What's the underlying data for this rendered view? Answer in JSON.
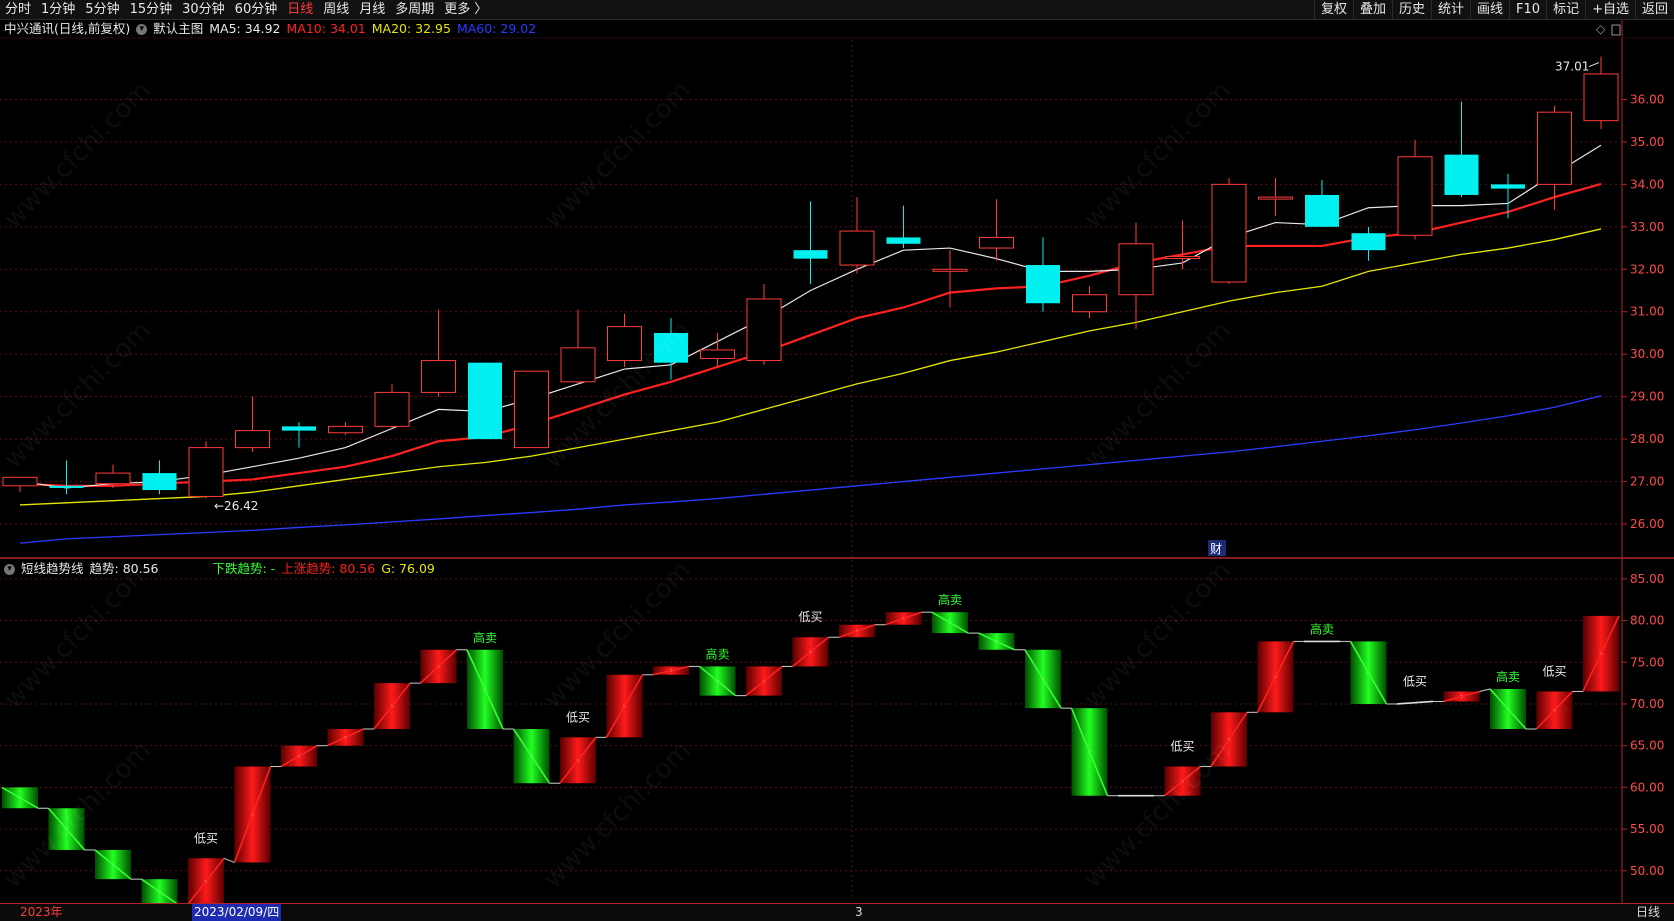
{
  "toolbar": {
    "left": [
      "分时",
      "1分钟",
      "5分钟",
      "15分钟",
      "30分钟",
      "60分钟",
      "日线",
      "周线",
      "月线",
      "多周期",
      "更多 〉"
    ],
    "active": "日线",
    "right": [
      "复权",
      "叠加",
      "历史",
      "统计",
      "画线",
      "F10",
      "标记",
      "+自选",
      "返回"
    ]
  },
  "legend_main": {
    "title": "中兴通讯(日线,前复权)",
    "template": "默认主图",
    "ma5": "MA5: 34.92",
    "ma10": "MA10: 34.01",
    "ma20": "MA20: 32.95",
    "ma60": "MA60: 29.02"
  },
  "legend_sub": {
    "title": "短线趋势线",
    "trend": "趋势: 80.56",
    "down": "下跌趋势: -",
    "up": "上涨趋势: 80.56",
    "g": "G: 76.09"
  },
  "annotations": {
    "high_price": "37.01",
    "low_price": "26.42",
    "fin_marker": "财"
  },
  "date_bar": {
    "year": "2023年",
    "selected": "2023/02/09/四",
    "month": "3",
    "period": "日线"
  },
  "watermark": "www.cfchi.com",
  "colors": {
    "up": "#ff3b3b",
    "down": "#00f0f0",
    "ma5": "#e8e8e8",
    "ma10": "#ff2020",
    "ma20": "#e6e600",
    "ma60": "#2b3bff",
    "grid": "#5a0f0f",
    "axis": "#b0262a"
  },
  "chart_data": [
    {
      "type": "candlestick",
      "title": "中兴通讯(日线,前复权)",
      "y_ticks": [
        26.0,
        27.0,
        28.0,
        29.0,
        30.0,
        31.0,
        32.0,
        33.0,
        34.0,
        35.0,
        36.0
      ],
      "ylim": [
        25.2,
        37.4
      ],
      "candles": [
        {
          "o": 26.9,
          "h": 27.05,
          "l": 26.75,
          "c": 27.1
        },
        {
          "o": 26.9,
          "h": 27.5,
          "l": 26.7,
          "c": 26.85
        },
        {
          "o": 26.95,
          "h": 27.4,
          "l": 26.85,
          "c": 27.2
        },
        {
          "o": 27.2,
          "h": 27.5,
          "l": 26.7,
          "c": 26.8
        },
        {
          "o": 26.65,
          "h": 27.95,
          "l": 26.6,
          "c": 27.8
        },
        {
          "o": 27.8,
          "h": 29.0,
          "l": 27.7,
          "c": 28.2
        },
        {
          "o": 28.3,
          "h": 28.4,
          "l": 27.8,
          "c": 28.2
        },
        {
          "o": 28.15,
          "h": 28.4,
          "l": 28.1,
          "c": 28.3
        },
        {
          "o": 28.3,
          "h": 29.3,
          "l": 28.25,
          "c": 29.1
        },
        {
          "o": 29.1,
          "h": 31.05,
          "l": 29.0,
          "c": 29.85
        },
        {
          "o": 29.8,
          "h": 29.8,
          "l": 28.0,
          "c": 28.0
        },
        {
          "o": 27.8,
          "h": 29.6,
          "l": 27.8,
          "c": 29.6
        },
        {
          "o": 29.35,
          "h": 31.05,
          "l": 29.3,
          "c": 30.15
        },
        {
          "o": 29.85,
          "h": 30.95,
          "l": 29.7,
          "c": 30.65
        },
        {
          "o": 30.5,
          "h": 30.85,
          "l": 29.4,
          "c": 29.8
        },
        {
          "o": 29.9,
          "h": 30.5,
          "l": 29.7,
          "c": 30.1
        },
        {
          "o": 29.85,
          "h": 31.65,
          "l": 29.75,
          "c": 31.3
        },
        {
          "o": 32.45,
          "h": 33.6,
          "l": 31.65,
          "c": 32.25
        },
        {
          "o": 32.1,
          "h": 33.7,
          "l": 31.9,
          "c": 32.9
        },
        {
          "o": 32.75,
          "h": 33.5,
          "l": 32.5,
          "c": 32.6
        },
        {
          "o": 32.0,
          "h": 32.45,
          "l": 31.1,
          "c": 32.0
        },
        {
          "o": 32.5,
          "h": 33.65,
          "l": 32.2,
          "c": 32.75
        },
        {
          "o": 32.1,
          "h": 32.75,
          "l": 31.0,
          "c": 31.2
        },
        {
          "o": 31.0,
          "h": 31.6,
          "l": 30.85,
          "c": 31.4
        },
        {
          "o": 31.4,
          "h": 33.1,
          "l": 30.6,
          "c": 32.6
        },
        {
          "o": 32.3,
          "h": 33.15,
          "l": 32.0,
          "c": 32.3
        },
        {
          "o": 31.7,
          "h": 34.15,
          "l": 31.65,
          "c": 34.0
        },
        {
          "o": 33.7,
          "h": 34.15,
          "l": 33.25,
          "c": 33.7
        },
        {
          "o": 33.75,
          "h": 34.1,
          "l": 33.0,
          "c": 33.0
        },
        {
          "o": 32.85,
          "h": 33.0,
          "l": 32.2,
          "c": 32.45
        },
        {
          "o": 32.8,
          "h": 35.05,
          "l": 32.7,
          "c": 34.65
        },
        {
          "o": 34.7,
          "h": 35.95,
          "l": 33.7,
          "c": 33.75
        },
        {
          "o": 34.0,
          "h": 34.25,
          "l": 33.2,
          "c": 33.9
        },
        {
          "o": 34.0,
          "h": 35.85,
          "l": 33.4,
          "c": 35.7
        },
        {
          "o": 35.5,
          "h": 37.01,
          "l": 35.3,
          "c": 36.6
        }
      ],
      "ma5": [
        27.0,
        26.85,
        26.95,
        27.0,
        27.15,
        27.35,
        27.55,
        27.8,
        28.25,
        28.7,
        28.65,
        28.95,
        29.3,
        29.65,
        29.75,
        30.3,
        30.85,
        31.5,
        32.0,
        32.45,
        32.5,
        32.25,
        31.95,
        31.95,
        32.0,
        32.15,
        32.75,
        33.1,
        33.05,
        33.45,
        33.5,
        33.5,
        33.55,
        34.25,
        34.92
      ],
      "ma10": [
        26.95,
        26.9,
        26.9,
        26.95,
        27.0,
        27.05,
        27.2,
        27.35,
        27.6,
        27.95,
        28.05,
        28.35,
        28.7,
        29.05,
        29.35,
        29.7,
        30.05,
        30.45,
        30.85,
        31.1,
        31.45,
        31.55,
        31.6,
        31.85,
        32.15,
        32.35,
        32.55,
        32.55,
        32.55,
        32.75,
        32.85,
        33.1,
        33.35,
        33.7,
        34.01
      ],
      "ma20": [
        26.45,
        26.5,
        26.55,
        26.6,
        26.65,
        26.75,
        26.9,
        27.05,
        27.2,
        27.35,
        27.45,
        27.6,
        27.8,
        28.0,
        28.2,
        28.4,
        28.7,
        29.0,
        29.3,
        29.55,
        29.85,
        30.05,
        30.3,
        30.55,
        30.75,
        31.0,
        31.25,
        31.45,
        31.6,
        31.95,
        32.15,
        32.35,
        32.5,
        32.7,
        32.95
      ],
      "ma60": [
        25.55,
        25.65,
        25.7,
        25.75,
        25.8,
        25.85,
        25.92,
        25.98,
        26.05,
        26.12,
        26.2,
        26.27,
        26.35,
        26.45,
        26.52,
        26.6,
        26.7,
        26.8,
        26.9,
        27.0,
        27.1,
        27.2,
        27.3,
        27.4,
        27.5,
        27.6,
        27.7,
        27.82,
        27.95,
        28.08,
        28.22,
        28.38,
        28.55,
        28.75,
        29.02
      ]
    },
    {
      "type": "bar",
      "title": "短线趋势线",
      "y_ticks": [
        50.0,
        55.0,
        60.0,
        65.0,
        70.0,
        75.0,
        80.0,
        85.0
      ],
      "ylim": [
        46.5,
        87.5
      ],
      "bars": [
        {
          "a": 60.0,
          "b": 57.5,
          "dir": "down"
        },
        {
          "a": 57.5,
          "b": 52.5,
          "dir": "down"
        },
        {
          "a": 52.5,
          "b": 49.0,
          "dir": "down"
        },
        {
          "a": 49.0,
          "b": 46.0,
          "dir": "down"
        },
        {
          "a": 46.0,
          "b": 51.5,
          "dir": "up",
          "label": "低买"
        },
        {
          "a": 51.0,
          "b": 62.5,
          "dir": "up"
        },
        {
          "a": 62.5,
          "b": 65.0,
          "dir": "up"
        },
        {
          "a": 65.0,
          "b": 67.0,
          "dir": "up"
        },
        {
          "a": 67.0,
          "b": 72.5,
          "dir": "up"
        },
        {
          "a": 72.5,
          "b": 76.5,
          "dir": "up"
        },
        {
          "a": 76.5,
          "b": 67.0,
          "dir": "down",
          "label": "高卖"
        },
        {
          "a": 67.0,
          "b": 60.5,
          "dir": "down"
        },
        {
          "a": 60.5,
          "b": 66.0,
          "dir": "up",
          "label": "低买"
        },
        {
          "a": 66.0,
          "b": 73.5,
          "dir": "up"
        },
        {
          "a": 73.5,
          "b": 74.5,
          "dir": "up"
        },
        {
          "a": 74.5,
          "b": 71.0,
          "dir": "down",
          "label": "高卖"
        },
        {
          "a": 71.0,
          "b": 74.5,
          "dir": "up"
        },
        {
          "a": 74.5,
          "b": 78.0,
          "dir": "up",
          "label": "低买"
        },
        {
          "a": 78.0,
          "b": 79.5,
          "dir": "up"
        },
        {
          "a": 79.5,
          "b": 81.0,
          "dir": "up"
        },
        {
          "a": 81.0,
          "b": 78.5,
          "dir": "down",
          "label": "高卖"
        },
        {
          "a": 78.5,
          "b": 76.5,
          "dir": "down"
        },
        {
          "a": 76.5,
          "b": 69.5,
          "dir": "down"
        },
        {
          "a": 69.5,
          "b": 59.0,
          "dir": "down"
        },
        {
          "a": 59.0,
          "b": 59.0,
          "dir": "flat"
        },
        {
          "a": 59.0,
          "b": 62.5,
          "dir": "up",
          "label": "低买"
        },
        {
          "a": 62.5,
          "b": 69.0,
          "dir": "up"
        },
        {
          "a": 69.0,
          "b": 77.5,
          "dir": "up"
        },
        {
          "a": 77.5,
          "b": 77.5,
          "dir": "flat",
          "label": "高卖"
        },
        {
          "a": 77.5,
          "b": 70.0,
          "dir": "down"
        },
        {
          "a": 70.0,
          "b": 70.3,
          "dir": "flat",
          "label": "低买"
        },
        {
          "a": 70.3,
          "b": 71.5,
          "dir": "up"
        },
        {
          "a": 71.8,
          "b": 67.0,
          "dir": "down",
          "label": "高卖"
        },
        {
          "a": 67.0,
          "b": 71.5,
          "dir": "up",
          "label": "低买"
        },
        {
          "a": 71.5,
          "b": 80.56,
          "dir": "up"
        }
      ]
    }
  ]
}
